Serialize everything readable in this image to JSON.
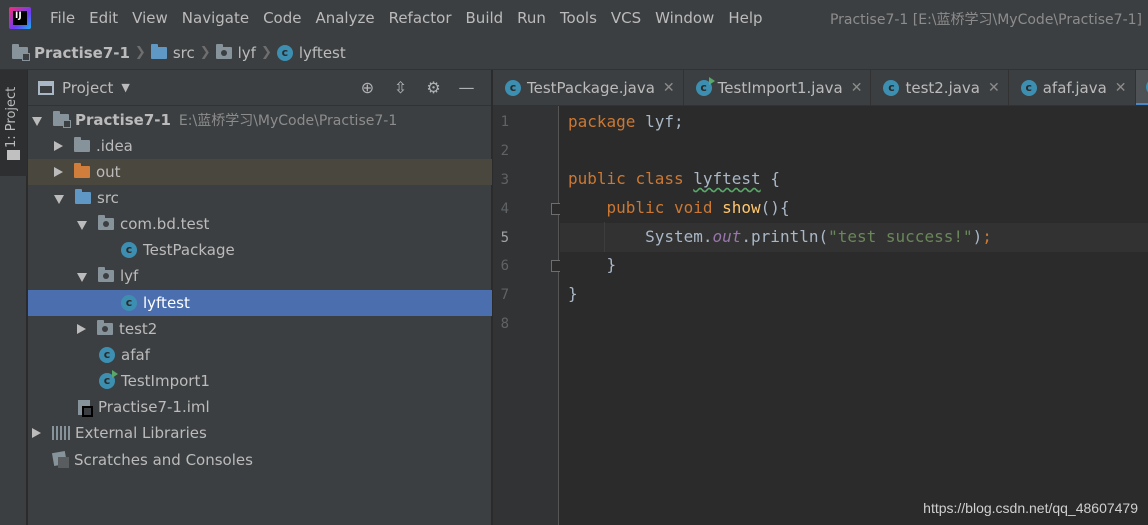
{
  "menubar": {
    "items": [
      "File",
      "Edit",
      "View",
      "Navigate",
      "Code",
      "Analyze",
      "Refactor",
      "Build",
      "Run",
      "Tools",
      "VCS",
      "Window",
      "Help"
    ],
    "window_title": "Practise7-1 [E:\\蓝桥学习\\MyCode\\Practise7-1]"
  },
  "breadcrumb": [
    "Practise7-1",
    "src",
    "lyf",
    "lyftest"
  ],
  "toolstrip": {
    "label": "1: Project"
  },
  "project_panel": {
    "title": "Project",
    "tree": [
      {
        "label": "Practise7-1",
        "extra": "E:\\蓝桥学习\\MyCode\\Practise7-1"
      },
      {
        "label": ".idea"
      },
      {
        "label": "out"
      },
      {
        "label": "src"
      },
      {
        "label": "com.bd.test"
      },
      {
        "label": "TestPackage"
      },
      {
        "label": "lyf"
      },
      {
        "label": "lyftest"
      },
      {
        "label": "test2"
      },
      {
        "label": "afaf"
      },
      {
        "label": "TestImport1"
      },
      {
        "label": "Practise7-1.iml"
      },
      {
        "label": "External Libraries"
      },
      {
        "label": "Scratches and Consoles"
      }
    ]
  },
  "editor": {
    "tabs": [
      "TestPackage.java",
      "TestImport1.java",
      "test2.java",
      "afaf.java"
    ],
    "line_numbers": [
      "1",
      "2",
      "3",
      "4",
      "5",
      "6",
      "7",
      "8"
    ],
    "code": {
      "l1_kw": "package",
      "l1_rest": " lyf;",
      "l3_kw1": "public",
      "l3_kw2": "class",
      "l3_name": "lyftest",
      "l3_rest": " {",
      "l4_kw1": "public",
      "l4_kw2": "void",
      "l4_fn": "show",
      "l4_rest": "(){",
      "l5_a": "System.",
      "l5_fld": "out",
      "l5_b": ".println(",
      "l5_str": "\"test success!\"",
      "l5_c": ")",
      "l5_d": ";",
      "l6": "}",
      "l7": "}"
    },
    "current_line": 5
  },
  "watermark": "https://blog.csdn.net/qq_48607479",
  "colors": {
    "keyword": "#cc7832",
    "function": "#ffc66d",
    "string": "#6a8759",
    "field": "#9876aa",
    "selection": "#4b6eaf"
  }
}
